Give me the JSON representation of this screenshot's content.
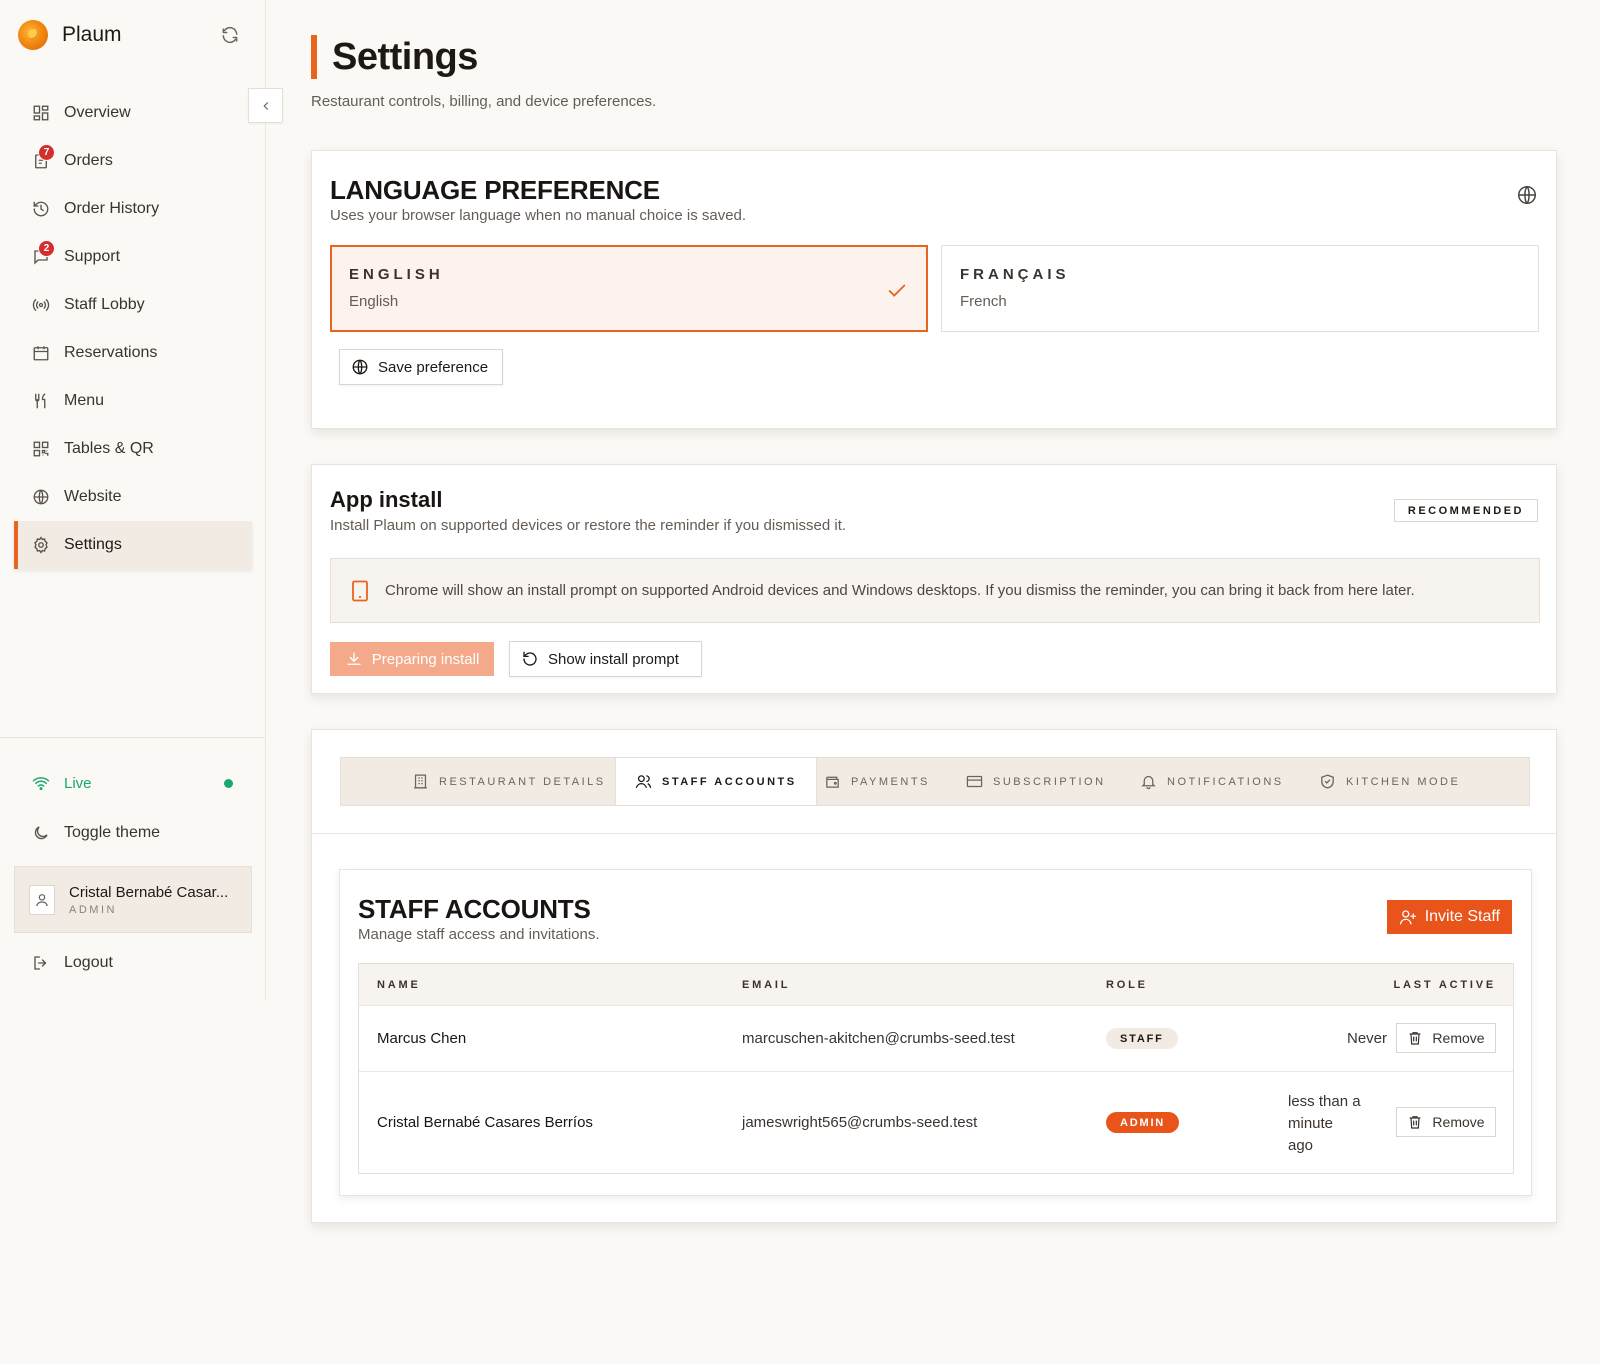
{
  "brand": {
    "name": "Plaum"
  },
  "sidebar": {
    "items": [
      {
        "label": "Overview",
        "icon": "grid-icon"
      },
      {
        "label": "Orders",
        "icon": "clipboard-icon",
        "badge": "7"
      },
      {
        "label": "Order History",
        "icon": "history-icon"
      },
      {
        "label": "Support",
        "icon": "message-icon",
        "badge": "2"
      },
      {
        "label": "Staff Lobby",
        "icon": "broadcast-icon"
      },
      {
        "label": "Reservations",
        "icon": "calendar-icon"
      },
      {
        "label": "Menu",
        "icon": "utensils-icon"
      },
      {
        "label": "Tables & QR",
        "icon": "qr-icon"
      },
      {
        "label": "Website",
        "icon": "globe-icon"
      },
      {
        "label": "Settings",
        "icon": "gear-icon",
        "active": true
      }
    ],
    "live_label": "Live",
    "toggle_theme_label": "Toggle theme",
    "user": {
      "name": "Cristal Bernabé Casar...",
      "role": "ADMIN"
    },
    "logout_label": "Logout"
  },
  "page": {
    "title": "Settings",
    "subtitle": "Restaurant controls, billing, and device preferences."
  },
  "language": {
    "title": "LANGUAGE PREFERENCE",
    "description": "Uses your browser language when no manual choice is saved.",
    "options": [
      {
        "code": "ENGLISH",
        "name": "English",
        "selected": true
      },
      {
        "code": "FRANÇAIS",
        "name": "French",
        "selected": false
      }
    ],
    "save_label": "Save preference"
  },
  "install": {
    "title": "App install",
    "description": "Install Plaum on supported devices or restore the reminder if you dismissed it.",
    "badge": "RECOMMENDED",
    "notice": "Chrome will show an install prompt on supported Android devices and Windows desktops. If you dismiss the reminder, you can bring it back from here later.",
    "preparing_label": "Preparing install",
    "show_prompt_label": "Show install prompt"
  },
  "tabs": [
    {
      "label": "RESTAURANT DETAILS",
      "icon": "building-icon"
    },
    {
      "label": "STAFF ACCOUNTS",
      "icon": "users-icon",
      "active": true
    },
    {
      "label": "PAYMENTS",
      "icon": "wallet-icon"
    },
    {
      "label": "SUBSCRIPTION",
      "icon": "credit-card-icon"
    },
    {
      "label": "NOTIFICATIONS",
      "icon": "bell-icon"
    },
    {
      "label": "KITCHEN MODE",
      "icon": "shield-check-icon"
    }
  ],
  "staff": {
    "title": "STAFF ACCOUNTS",
    "description": "Manage staff access and invitations.",
    "invite_label": "Invite Staff",
    "columns": {
      "name": "NAME",
      "email": "EMAIL",
      "role": "ROLE",
      "last_active": "LAST ACTIVE"
    },
    "rows": [
      {
        "name": "Marcus Chen",
        "email": "marcuschen-akitchen@crumbs-seed.test",
        "role": "STAFF",
        "last_active": "Never",
        "remove_label": "Remove"
      },
      {
        "name": "Cristal Bernabé Casares Berríos",
        "email": "jameswright565@crumbs-seed.test",
        "role": "ADMIN",
        "last_active_lines": [
          "less than a",
          "minute",
          "ago"
        ],
        "remove_label": "Remove"
      }
    ]
  },
  "colors": {
    "accent": "#e8651f",
    "accent_strong": "#e8541a",
    "live": "#1aa86d",
    "badge": "#d32f2f"
  }
}
